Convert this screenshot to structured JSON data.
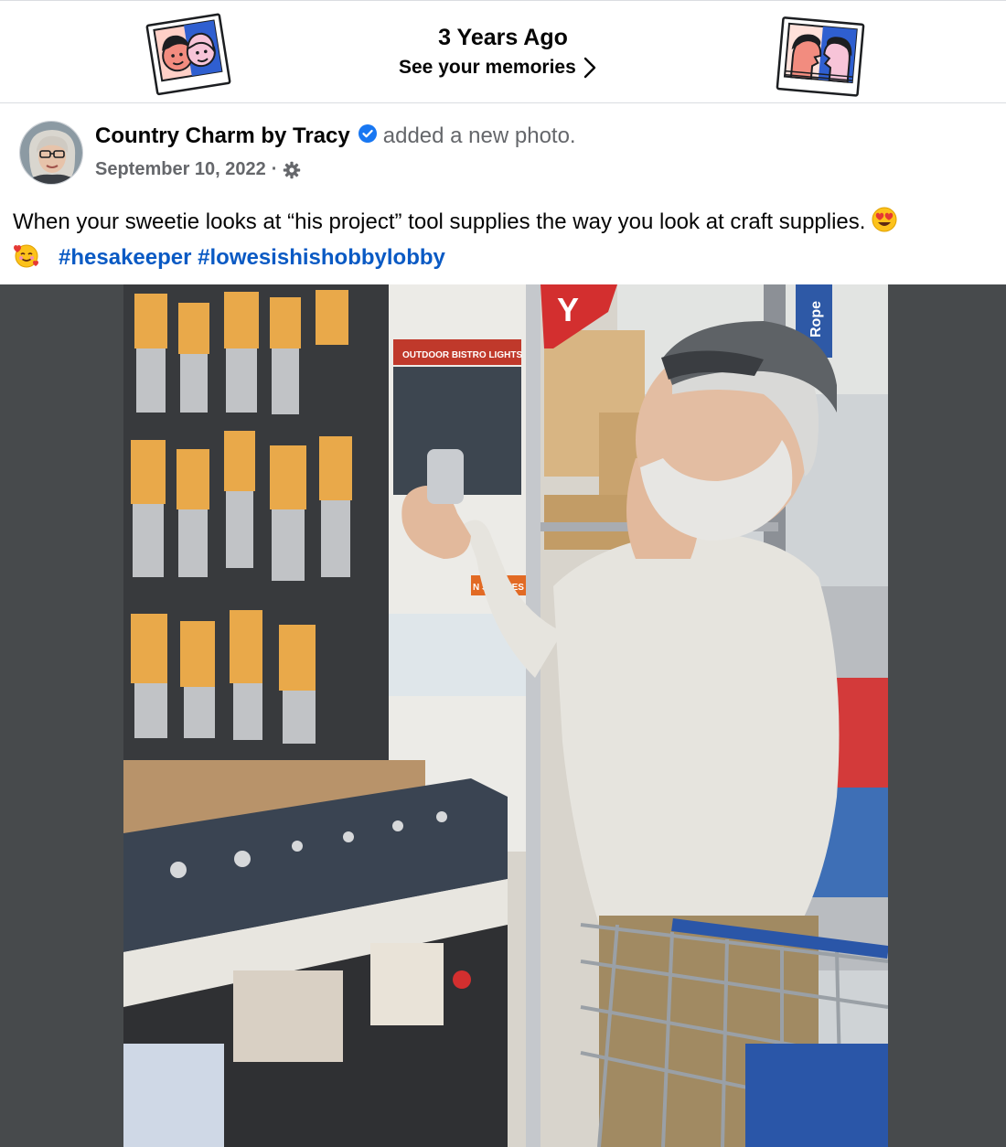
{
  "memories": {
    "title": "3 Years Ago",
    "link_label": "See your memories",
    "chevron_icon": "chevron-right-icon",
    "left_icon": "memories-faces-icon",
    "right_icon": "memories-kiss-icon"
  },
  "post": {
    "author": "Country Charm by Tracy",
    "verified_icon": "verified-badge-icon",
    "action": "added a new photo.",
    "date": "September 10, 2022",
    "separator": "·",
    "audience_icon": "gear-icon",
    "caption_text": "When your sweetie looks at “his project” tool supplies the way you look at craft supplies.",
    "emoji_1": "heart-eyes-emoji-icon",
    "emoji_2": "smiling-face-with-hearts-emoji-icon",
    "hashtags": [
      "#hesakeeper",
      "#lowesishishobbylobby"
    ],
    "photo_icon": "photo-man-in-hardware-store"
  },
  "colors": {
    "text": "#050505",
    "secondary": "#65676b",
    "link": "#0a5ac4",
    "verified": "#1877f2",
    "photo_backdrop": "#474a4c"
  },
  "photo_signs": {
    "rope": "Rope",
    "outdoor_lights": "OUTDOOR BISTRO LIGHTS",
    "shelves": "N SHELVES",
    "aisle_letter": "Y"
  }
}
